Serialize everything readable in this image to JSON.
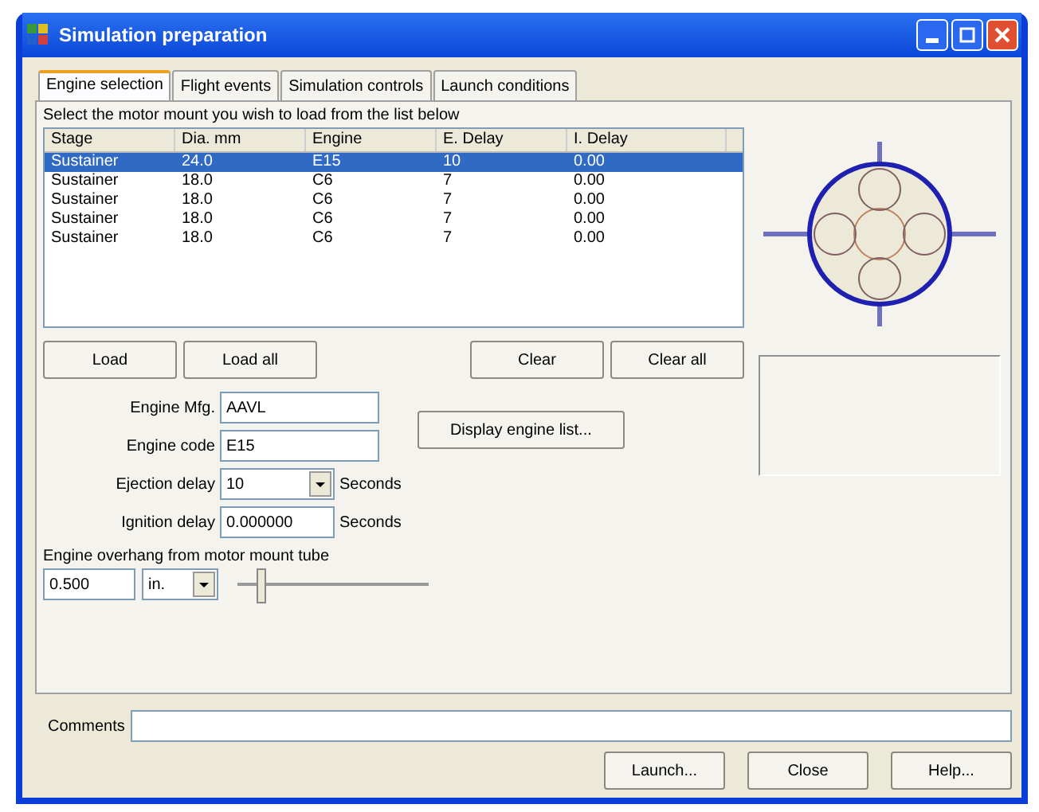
{
  "window": {
    "title": "Simulation preparation"
  },
  "tabs": [
    {
      "label": "Engine selection",
      "selected": true
    },
    {
      "label": "Flight events",
      "selected": false
    },
    {
      "label": "Simulation controls",
      "selected": false
    },
    {
      "label": "Launch conditions",
      "selected": false
    }
  ],
  "instruction": "Select the motor mount you wish to load from the list below",
  "table": {
    "columns": [
      "Stage",
      "Dia. mm",
      "Engine",
      "E. Delay",
      "I. Delay"
    ],
    "rows": [
      {
        "cells": [
          "Sustainer",
          "24.0",
          "E15",
          "10",
          "0.00"
        ],
        "selected": true
      },
      {
        "cells": [
          "Sustainer",
          "18.0",
          "C6",
          "7",
          "0.00"
        ],
        "selected": false
      },
      {
        "cells": [
          "Sustainer",
          "18.0",
          "C6",
          "7",
          "0.00"
        ],
        "selected": false
      },
      {
        "cells": [
          "Sustainer",
          "18.0",
          "C6",
          "7",
          "0.00"
        ],
        "selected": false
      },
      {
        "cells": [
          "Sustainer",
          "18.0",
          "C6",
          "7",
          "0.00"
        ],
        "selected": false
      }
    ]
  },
  "list_buttons": [
    "Load",
    "Load all",
    "Clear",
    "Clear all"
  ],
  "fields": [
    {
      "label": "Engine Mfg.",
      "value": "AAVL",
      "kind": "text"
    },
    {
      "label": "Engine code",
      "value": "E15",
      "kind": "text"
    },
    {
      "label": "Ejection delay",
      "value": "10",
      "kind": "combo",
      "unit": "Seconds"
    },
    {
      "label": "Ignition delay",
      "value": "0.000000",
      "kind": "text",
      "unit": "Seconds"
    }
  ],
  "display_button": "Display engine list...",
  "overhang": {
    "label": "Engine overhang from motor mount tube",
    "value": "0.500",
    "unit": "in.",
    "level": 0.1
  },
  "comments": {
    "label": "Comments"
  },
  "buttons": [
    "Launch...",
    "Close",
    "Help..."
  ]
}
